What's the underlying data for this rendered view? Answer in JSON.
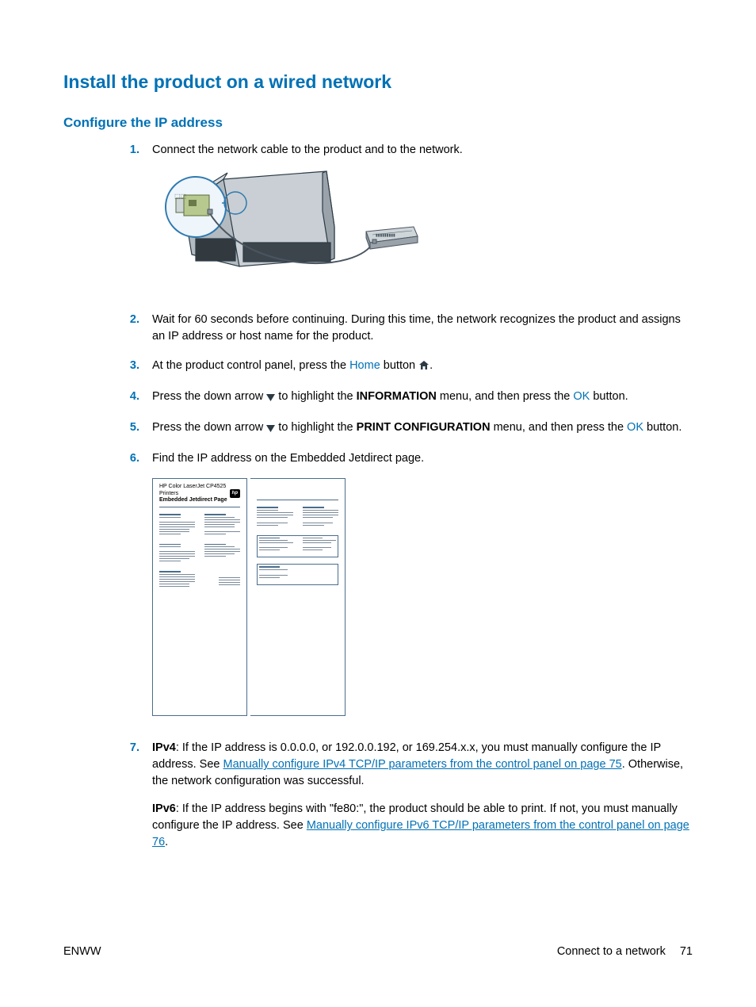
{
  "h1": "Install the product on a wired network",
  "h2": "Configure the IP address",
  "steps": {
    "s1": {
      "num": "1.",
      "text": "Connect the network cable to the product and to the network."
    },
    "s2": {
      "num": "2.",
      "text": "Wait for 60 seconds before continuing. During this time, the network recognizes the product and assigns an IP address or host name for the product."
    },
    "s3": {
      "num": "3.",
      "pre": "At the product control panel, press the ",
      "home": "Home",
      "post": " button "
    },
    "s4": {
      "num": "4.",
      "pre": "Press the down arrow ",
      "mid": " to highlight the ",
      "info": "INFORMATION",
      "mid2": " menu, and then press the ",
      "ok": "OK",
      "post": " button."
    },
    "s5": {
      "num": "5.",
      "pre": "Press the down arrow ",
      "mid": " to highlight the ",
      "pc": "PRINT CONFIGURATION",
      "mid2": " menu, and then press the ",
      "ok": "OK",
      "post": " button."
    },
    "s6": {
      "num": "6.",
      "text": "Find the IP address on the Embedded Jetdirect page."
    },
    "s7": {
      "num": "7.",
      "v4label": "IPv4",
      "v4a": ": If the IP address is 0.0.0.0, or 192.0.0.192, or 169.254.x.x, you must manually configure the IP address. See ",
      "v4link": "Manually configure IPv4 TCP/IP parameters from the control panel on page 75",
      "v4b": ". Otherwise, the network configuration was successful.",
      "v6label": "IPv6",
      "v6a": ": If the IP address begins with \"fe80:\", the product should be able to print. If not, you must manually configure the IP address. See ",
      "v6link": "Manually configure IPv6 TCP/IP parameters from the control panel on page 76",
      "v6b": "."
    }
  },
  "config_page": {
    "line1": "HP Color LaserJet CP4525 Printers",
    "line2": "Embedded Jetdirect Page"
  },
  "footer": {
    "left": "ENWW",
    "right_label": "Connect to a network",
    "page": "71"
  }
}
